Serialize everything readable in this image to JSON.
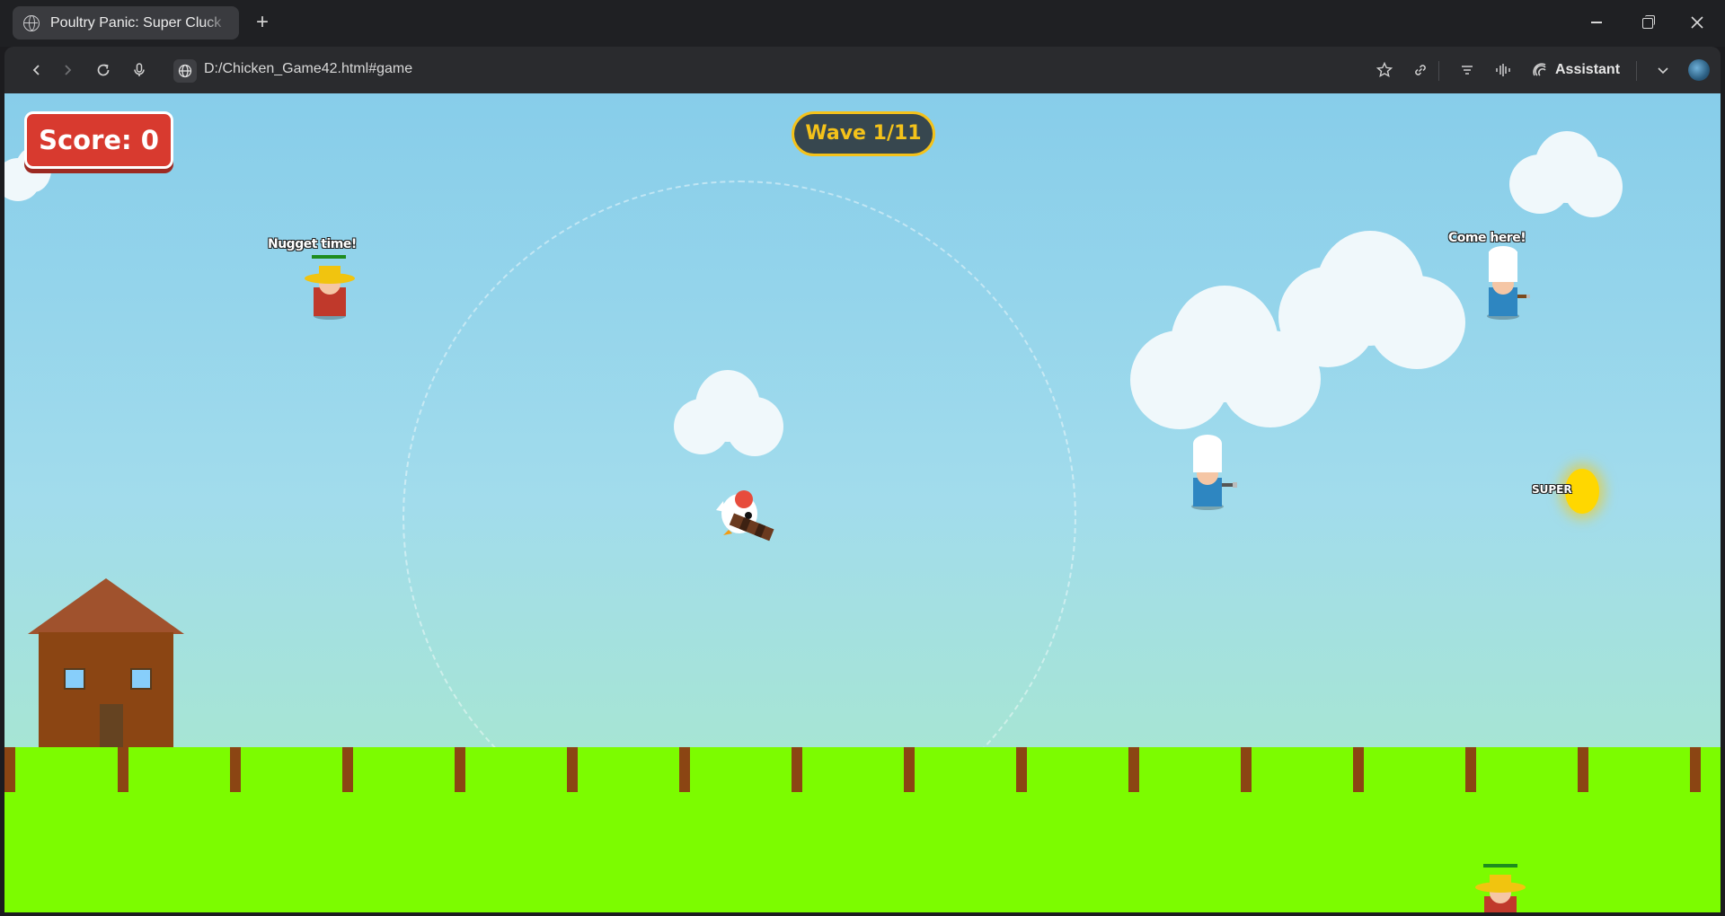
{
  "browser": {
    "tab_title": "Poultry Panic: Super Cluck",
    "new_tab_icon": "plus-icon",
    "address": "D:/Chicken_Game42.html#game",
    "assistant_label": "Assistant"
  },
  "game": {
    "score_label": "Score: 0",
    "wave_label": "Wave 1/11",
    "colors": {
      "sky_top": "#87cdea",
      "sky_bottom": "#a9ebc4",
      "grass": "#7cfc00",
      "fence": "#8b4513",
      "score_bg": "#d83a2f",
      "wave_bg": "#37474f",
      "wave_accent": "#f4c21a"
    },
    "enemies": [
      {
        "type": "farmer",
        "speech": "Nugget time!"
      },
      {
        "type": "chef",
        "speech": "Come here!"
      },
      {
        "type": "chef",
        "speech": ""
      },
      {
        "type": "farmer",
        "speech": ""
      }
    ],
    "powerup_label": "SUPER",
    "player": "chicken-with-gun"
  }
}
